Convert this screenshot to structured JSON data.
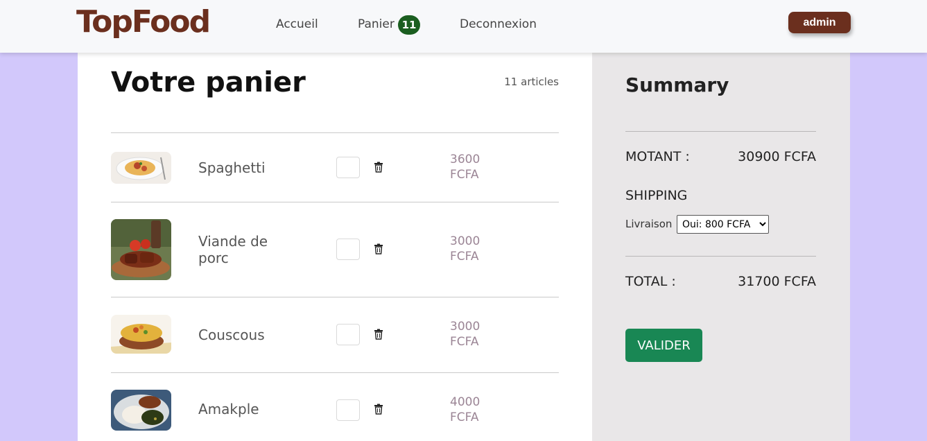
{
  "brand": {
    "logo": "TopFood",
    "color": "#6b2f1e"
  },
  "nav": {
    "home": "Accueil",
    "cart": "Panier",
    "cart_count": "11",
    "logout": "Deconnexion",
    "user": "admin"
  },
  "cart": {
    "title": "Votre panier",
    "count_label": "11 articles",
    "items": [
      {
        "name": "Spaghetti",
        "price_amount": "3600",
        "price_currency": "FCFA",
        "image": "spaghetti-plate"
      },
      {
        "name": "Viande de porc",
        "price_amount": "3000",
        "price_currency": "FCFA",
        "image": "grilled-pork"
      },
      {
        "name": "Couscous",
        "price_amount": "3000",
        "price_currency": "FCFA",
        "image": "couscous-bowl"
      },
      {
        "name": "Amakple",
        "price_amount": "4000",
        "price_currency": "FCFA",
        "image": "amakple-plate"
      }
    ]
  },
  "summary": {
    "title": "Summary",
    "amount_label": "MOTANT :",
    "amount_value": "30900 FCFA",
    "shipping_label": "SHIPPING",
    "delivery_label": "Livraison",
    "delivery_selected": "Oui: 800 FCFA",
    "total_label": "TOTAL :",
    "total_value": "31700 FCFA",
    "submit_label": "VALIDER"
  },
  "colors": {
    "page_bg": "#d2c8fb",
    "badge": "#1b5e20",
    "submit": "#198754",
    "price": "#9b8595"
  }
}
